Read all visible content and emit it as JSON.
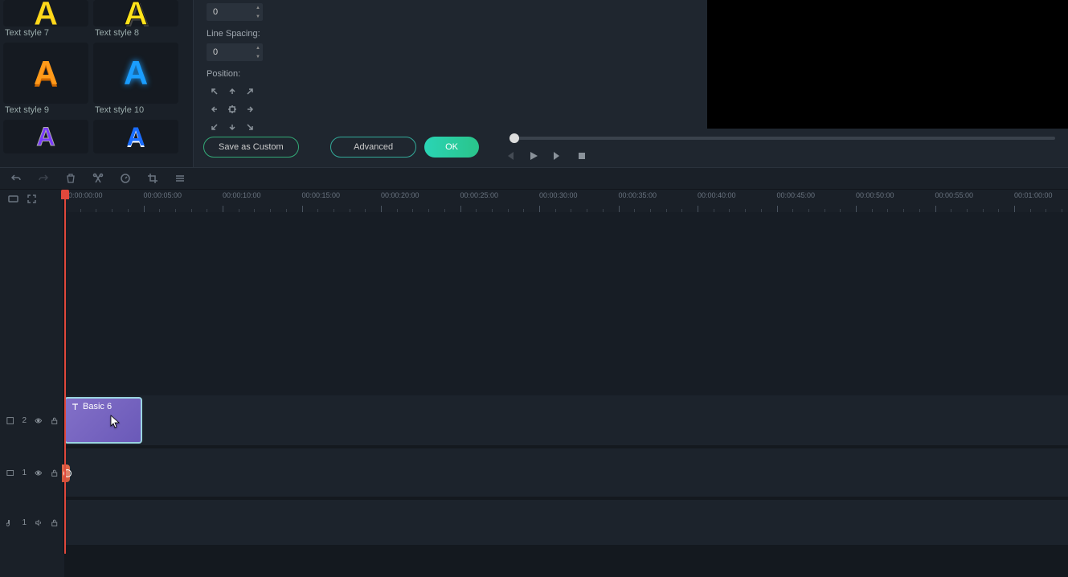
{
  "styles": {
    "items": [
      {
        "label": "Text style 7"
      },
      {
        "label": "Text style 8"
      },
      {
        "label": "Text style 9"
      },
      {
        "label": "Text style 10"
      }
    ]
  },
  "properties": {
    "char_spacing_value": "0",
    "line_spacing_label": "Line Spacing:",
    "line_spacing_value": "0",
    "position_label": "Position:"
  },
  "buttons": {
    "save_custom": "Save as Custom",
    "advanced": "Advanced",
    "ok": "OK"
  },
  "ruler": {
    "marks": [
      "00:00:00:00",
      "00:00:05:00",
      "00:00:10:00",
      "00:00:15:00",
      "00:00:20:00",
      "00:00:25:00",
      "00:00:30:00",
      "00:00:35:00",
      "00:00:40:00",
      "00:00:45:00",
      "00:00:50:00",
      "00:00:55:00",
      "00:01:00:00"
    ]
  },
  "tracks": {
    "text": {
      "num": "2"
    },
    "video": {
      "num": "1"
    },
    "audio": {
      "num": "1"
    }
  },
  "clip": {
    "name": "Basic 6"
  }
}
